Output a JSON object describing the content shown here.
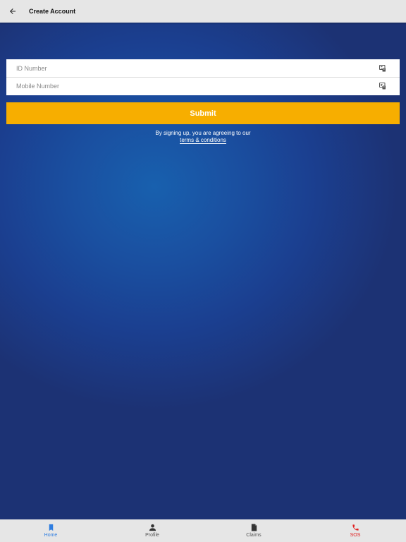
{
  "appbar": {
    "title": "Create Account"
  },
  "form": {
    "id_number": {
      "placeholder": "ID Number",
      "value": ""
    },
    "mobile_number": {
      "placeholder": "Mobile Number",
      "value": ""
    }
  },
  "submit_label": "Submit",
  "terms": {
    "prefix": "By signing up, you are agreeing to our",
    "link": "terms & conditions"
  },
  "bottom_nav": {
    "items": [
      {
        "label": "Home",
        "icon": "bookmark-icon"
      },
      {
        "label": "Profile",
        "icon": "person-icon"
      },
      {
        "label": "Claims",
        "icon": "document-icon"
      },
      {
        "label": "SOS",
        "icon": "phone-icon"
      }
    ]
  },
  "colors": {
    "accent": "#f7ae00",
    "background": "#1b3f90",
    "nav_active": "#2f7de0",
    "sos": "#e02020"
  }
}
